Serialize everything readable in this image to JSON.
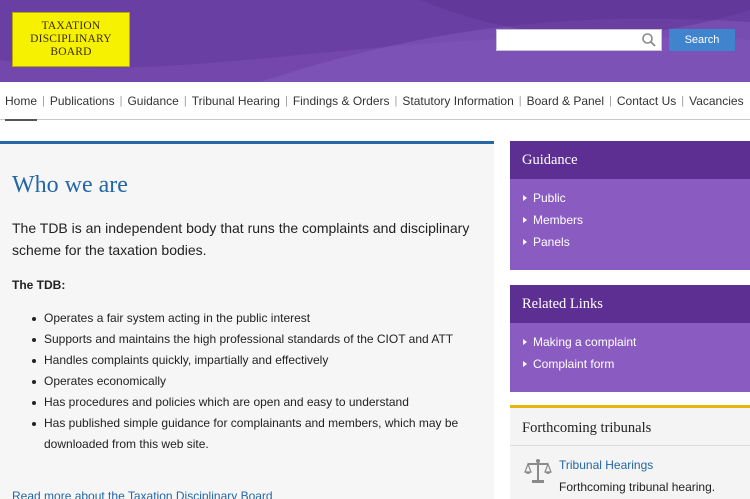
{
  "logo": {
    "line1": "TAXATION",
    "line2": "DISCIPLINARY",
    "line3": "BOARD"
  },
  "search": {
    "placeholder": "",
    "button_label": "Search"
  },
  "nav": {
    "items": [
      {
        "label": "Home",
        "active": true
      },
      {
        "label": "Publications"
      },
      {
        "label": "Guidance"
      },
      {
        "label": "Tribunal Hearing"
      },
      {
        "label": "Findings & Orders"
      },
      {
        "label": "Statutory Information"
      },
      {
        "label": "Board & Panel"
      },
      {
        "label": "Contact Us"
      },
      {
        "label": "Vacancies"
      }
    ],
    "separator": "|"
  },
  "main": {
    "title": "Who we are",
    "intro": "The TDB is an independent body that runs the complaints and disciplinary scheme for the taxation bodies.",
    "tdb_heading": "The TDB:",
    "bullets": [
      "Operates a fair system acting in the public interest",
      "Supports and maintains the high professional standards of the CIOT and ATT",
      "Handles complaints quickly, impartially and effectively",
      "Operates economically",
      "Has procedures and policies which are open and easy to understand",
      "Has published simple guidance for complainants and members, which may be downloaded from this web site."
    ],
    "read_more": "Read more about the Taxation Disciplinary Board"
  },
  "sidebar": {
    "guidance": {
      "title": "Guidance",
      "links": [
        "Public",
        "Members",
        "Panels"
      ]
    },
    "related": {
      "title": "Related Links",
      "links": [
        "Making a complaint",
        "Complaint form"
      ]
    },
    "forthcoming": {
      "title": "Forthcoming tribunals",
      "link": "Tribunal Hearings",
      "desc": "Forthcoming tribunal hearing."
    }
  },
  "colors": {
    "header_purple": "#6a3fa3",
    "panel_head": "#5d2f93",
    "panel_body": "#8a5cc2",
    "link_blue": "#2466a6",
    "search_button": "#3f84cc",
    "logo_yellow": "#f6f100",
    "accent_gold": "#e4b60c"
  }
}
